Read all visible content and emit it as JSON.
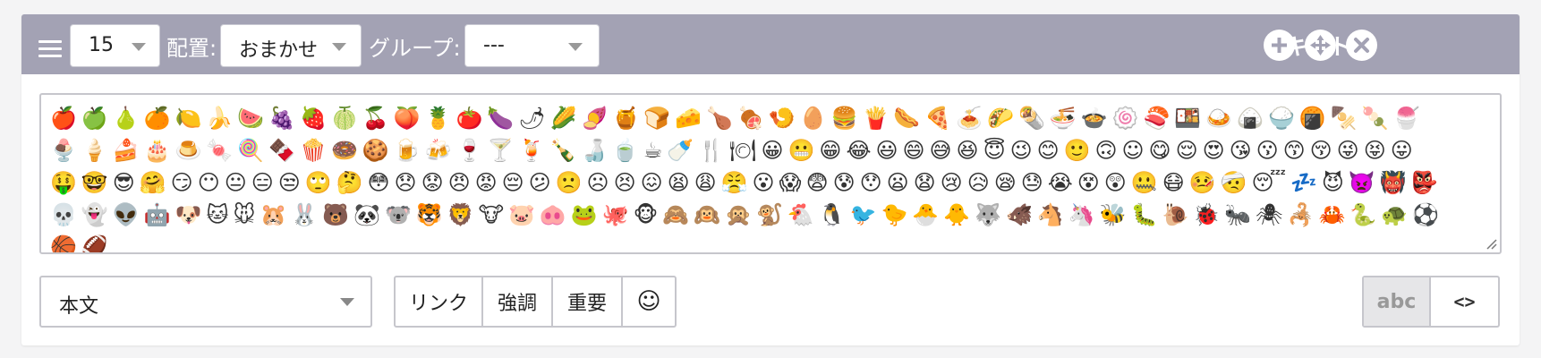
{
  "toolbar": {
    "size_value": "15",
    "placement_label": "配置:",
    "placement_value": "おまかせ",
    "group_label": "グループ:",
    "group_value": "---",
    "block_type": "テキスト",
    "icons": [
      "hamburger-icon",
      "plus-icon",
      "move-icon",
      "close-icon"
    ],
    "color": "#a3a2b4"
  },
  "editor": {
    "content": "🍎🍏🍐🍊🍋🍌🍉🍇🍓🍈🍒🍑🍍🍅🍆🌶🌽🍠🍯🍞🧀🍗🍖🍤🥚🍔🍟🌭🍕🍝🌮🌯🍜🍲🍥🍣🍱🍛🍙🍚🍘🍢🍡🍧🍨🍦🍰🎂🍮🍬🍭🍫🍿🍩🍪🍺🍻🍷🍸🍹🍾🍶🍵☕🍼🍴🍽😀😬😁😂😃😄😅😆😇😉😊🙂🙃☺😋😌😍😘😗😙😚😜😝😛🤑🤓😎🤗😏😶😐😑😒🙄🤔😳😞😟😠😡😔😕🙁☹😣😖😫😩😤😮😱😨😰😯😦😧😢😥😪😓😭😵😲🤐😷🤒🤕😴💤😈👿👹👺💀👻👽🤖🐶🐱🐭🐹🐰🐻🐼🐨🐯🦁🐮🐷🐽🐸🐙🐵🙈🙉🙊🐒🐔🐧🐦🐤🐣🐥🐺🐗🐴🦄🐝🐛🐌🐞🐜🕷🦂🦀🐍🐢⚽🏀🏈"
  },
  "format": {
    "value": "本文"
  },
  "buttons": {
    "link": "リンク",
    "emphasis": "強調",
    "important": "重要",
    "emoji": "☺"
  },
  "view": {
    "text": "abc",
    "code": "<>"
  }
}
